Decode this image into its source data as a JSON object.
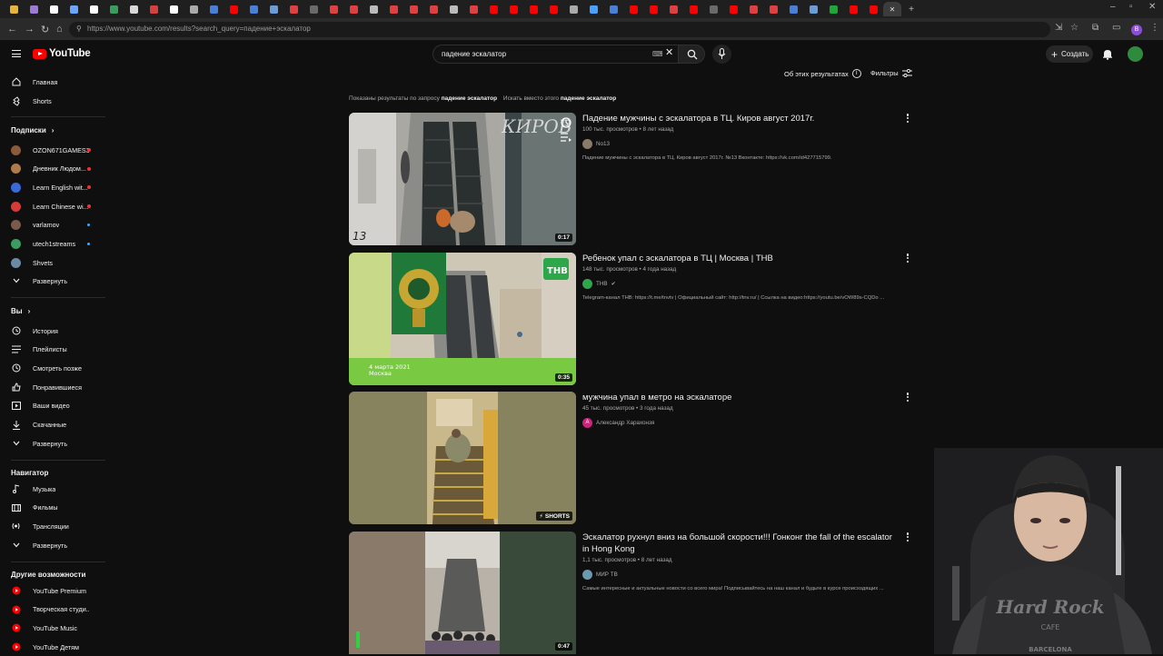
{
  "browser": {
    "url": "https://www.youtube.com/results?search_query=падение+эскалатор",
    "tab_colors": [
      "#e7b33c",
      "#9b7bd6",
      "#ffffff",
      "#6aa5ff",
      "#ffffff",
      "#3a9d5d",
      "#d8d8d8",
      "#d84040",
      "#ffffff",
      "#aaaaaa",
      "#4a7fd8",
      "#ff0000",
      "#4a7fd8",
      "#6a9dd8",
      "#e04040",
      "#6a6a6a",
      "#e04040",
      "#e04040",
      "#bbbbbb",
      "#e04040",
      "#e04040",
      "#e04040",
      "#bbbbbb",
      "#e04040",
      "#ff0000",
      "#ff0000",
      "#ff0000",
      "#ff0000",
      "#aaaaaa",
      "#4aa0ff",
      "#4a7fd8",
      "#ff0000",
      "#ff0000",
      "#e04040",
      "#ff0000",
      "#6a6a6a",
      "#ff0000",
      "#e04040",
      "#e04040",
      "#4a7fd8",
      "#6a9dd8",
      "#1fa83a",
      "#ff0000",
      "#ff0000"
    ],
    "profile_letter": "В"
  },
  "header": {
    "logo": "YouTube",
    "search_query": "падение эскалатор",
    "create_label": "Создать"
  },
  "sidebar": {
    "main": [
      {
        "label": "Главная",
        "icon": "home-icon"
      },
      {
        "label": "Shorts",
        "icon": "shorts-icon"
      }
    ],
    "subscriptions_title": "Подписки",
    "subscriptions": [
      {
        "label": "OZON671GAMES3",
        "color": "#8a5a3a",
        "dot": "live"
      },
      {
        "label": "Дневник Людом...",
        "color": "#b07a4a",
        "dot": "live"
      },
      {
        "label": "Learn English wit...",
        "color": "#3a6ad8",
        "dot": "live"
      },
      {
        "label": "Learn Chinese wi...",
        "color": "#d83a3a",
        "dot": "live"
      },
      {
        "label": "varlamov",
        "color": "#7a5a4a",
        "dot": "new"
      },
      {
        "label": "utech1streams",
        "color": "#3a9d5d",
        "dot": "new"
      },
      {
        "label": "Shvets",
        "color": "#6a8aa8",
        "dot": ""
      }
    ],
    "expand_label": "Развернуть",
    "you_title": "Вы",
    "you": [
      {
        "label": "История",
        "icon": "history-icon"
      },
      {
        "label": "Плейлисты",
        "icon": "playlists-icon"
      },
      {
        "label": "Смотреть позже",
        "icon": "watch-later-icon"
      },
      {
        "label": "Понравившиеся",
        "icon": "like-icon"
      },
      {
        "label": "Ваши видео",
        "icon": "your-videos-icon"
      },
      {
        "label": "Скачанные",
        "icon": "download-icon"
      }
    ],
    "explore_title": "Навигатор",
    "explore": [
      {
        "label": "Музыка",
        "icon": "music-icon"
      },
      {
        "label": "Фильмы",
        "icon": "movies-icon"
      },
      {
        "label": "Трансляции",
        "icon": "live-icon"
      }
    ],
    "more_title": "Другие возможности",
    "more": [
      {
        "label": "YouTube Premium"
      },
      {
        "label": "Творческая студи..."
      },
      {
        "label": "YouTube Music"
      },
      {
        "label": "YouTube Детям"
      }
    ]
  },
  "toolbar": {
    "about_results": "Об этих результатах",
    "filters": "Фильтры"
  },
  "correction": {
    "shown_prefix": "Показаны результаты по запросу",
    "shown_query": "падение эскалатор",
    "instead_prefix": "Искать вместо этого",
    "instead_query": "падение эскалатор"
  },
  "results": [
    {
      "title": "Падение мужчины с эскалатора в ТЦ. Киров август 2017г.",
      "meta": "100 тыс. просмотров • 8 лет назад",
      "channel": "No13",
      "channel_color": "#8a7a6a",
      "description": "Падение мужчины с эскалатора в ТЦ. Киров август 2017г. №13 Вконтакте: https://vk.com/id427715799.",
      "duration": "0:17",
      "thumb_label": "КИРОВ"
    },
    {
      "title": "Ребенок упал с эскалатора в ТЦ | Москва | ТНВ",
      "meta": "148 тыс. просмотров • 4 года назад",
      "channel": "ТНВ",
      "channel_color": "#2ca84a",
      "description": "Telegram-канал ТНВ: https://t.me/tnvtv | Официальный сайт: http://tnv.ru/ | Ссылка на видео:https://youtu.be/vOW89s-CQDo ...",
      "duration": "0:35",
      "thumb_label": "ТНВ",
      "thumb_date": "4 марта 2021",
      "thumb_city": "Москва"
    },
    {
      "title": "мужчина упал в метро на эскалаторе",
      "meta": "45 тыс. просмотров • 3 года назад",
      "channel": "Александр Харахонзя",
      "channel_color": "#c8267a",
      "channel_letter": "А",
      "description": "",
      "duration": "SHORTS"
    },
    {
      "title": "Эскалатор рухнул вниз на большой скорости!!! Гонконг the fall of the escalator in Hong Kong",
      "meta": "1,1 тыс. просмотров • 8 лет назад",
      "channel": "МИР ТВ",
      "channel_color": "#6a9ab0",
      "description": "Самые интересные и актуальные новости со всего мира! Подписывайтесь на наш канал и будьте в курсе происходящих ...",
      "duration": "0:47"
    }
  ],
  "webcam": {
    "shirt_text": "Hard Rock",
    "shirt_text2": "CAFE",
    "shirt_city": "BARCELONA"
  }
}
